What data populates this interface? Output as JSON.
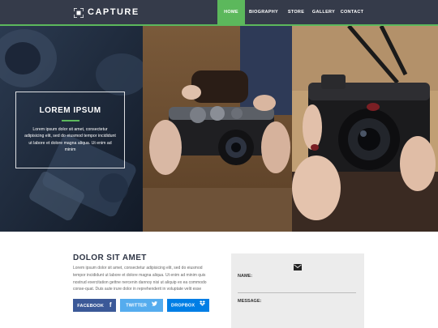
{
  "brand": {
    "name": "CAPTURE"
  },
  "nav": {
    "items": [
      "HOME",
      "BIOGRAPHY",
      "STORE",
      "GALLERY",
      "CONTACT"
    ],
    "active": "HOME"
  },
  "hero": {
    "title": "LOREM IPSUM",
    "text": "Lorem ipsum dolor sit amet, consectetur adipisicing elit, sed do eiusmod tempor incididunt ut labore et dolore magna aliqua. Ut enim ad minim"
  },
  "about": {
    "title": "DOLOR SIT AMET",
    "text": "Lorem ipsum dolor sit amet, consectetur adipisicing elit, sed do eiusmod tempor incididunt ut labore et dolore magna aliqua. Ut enim ad minim quis nostrud exercitation gettne nercenin dannoy nisi ut aliquip ex ea commodo conse-quat. Duis aute irure dolor in reprehenderit in voluptate velit esse"
  },
  "social": {
    "facebook": "FACEBOOK",
    "twitter": "TWITTER",
    "dropbox": "DROPBOX"
  },
  "contact_form": {
    "name_label": "NAME:",
    "message_label": "MESSAGE:"
  },
  "colors": {
    "nav_bg": "#353b4a",
    "accent_green": "#5cb85c",
    "facebook": "#3b5998",
    "twitter": "#55acee",
    "dropbox": "#007ee5",
    "form_bg": "#ececec"
  },
  "icons": {
    "logo": "camera-viewfinder-icon",
    "facebook": "facebook-icon",
    "twitter": "twitter-icon",
    "dropbox": "dropbox-icon",
    "contact": "envelope-icon"
  }
}
